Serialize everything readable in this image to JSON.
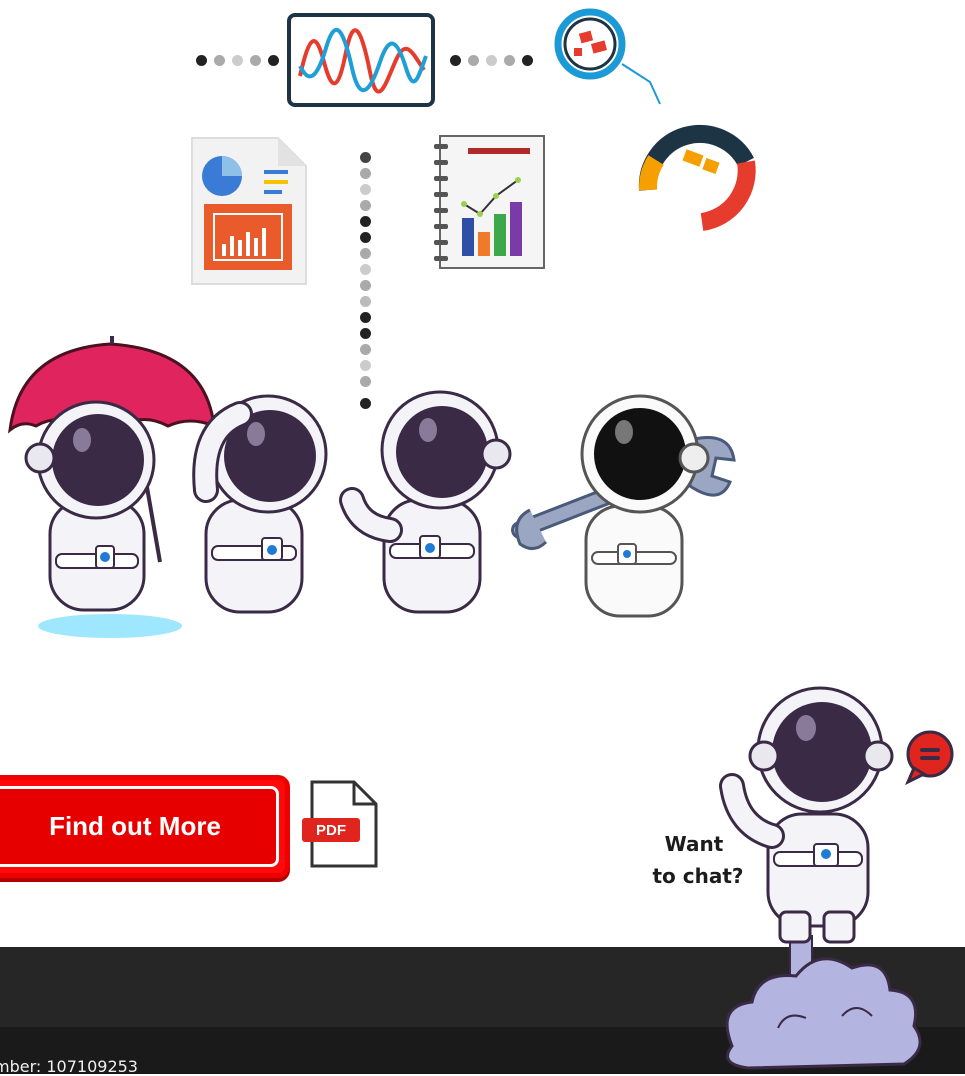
{
  "cta": {
    "label": "Find out More"
  },
  "pdf": {
    "label": "PDF"
  },
  "chat": {
    "line1": "Want",
    "line2": "to chat?"
  },
  "footer": {
    "text": "mber: 107109253"
  },
  "colors": {
    "brand_red": "#ff0a0a",
    "footer_dark": "#262626",
    "footer_darker": "#1a1a1a",
    "astronaut_visor": "#3a2a46",
    "umbrella": "#e0245e",
    "cloud": "#b4b4e0"
  },
  "icons": [
    "waveform-chart-icon",
    "magnifier-icon",
    "donut-gauge-icon",
    "report-document-icon",
    "notebook-chart-icon",
    "chat-bubble-icon",
    "pdf-file-icon",
    "rocket-cloud-icon"
  ]
}
